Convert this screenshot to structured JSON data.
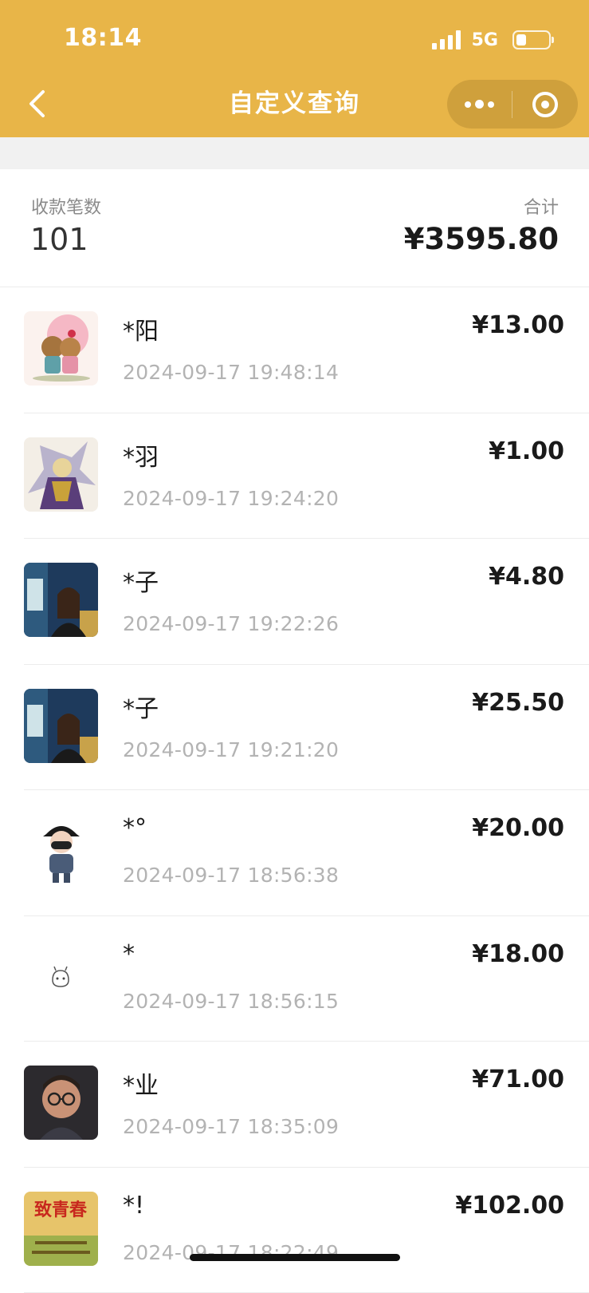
{
  "status_bar": {
    "time": "18:14",
    "network": "5G"
  },
  "nav": {
    "title": "自定义查询"
  },
  "summary": {
    "count_label": "收款笔数",
    "count_value": "101",
    "total_label": "合计",
    "total_value": "¥3595.80"
  },
  "transactions": [
    {
      "name": "*阳",
      "time": "2024-09-17 19:48:14",
      "amount": "¥13.00"
    },
    {
      "name": "*羽",
      "time": "2024-09-17 19:24:20",
      "amount": "¥1.00"
    },
    {
      "name": "*子",
      "time": "2024-09-17 19:22:26",
      "amount": "¥4.80"
    },
    {
      "name": "*子",
      "time": "2024-09-17 19:21:20",
      "amount": "¥25.50"
    },
    {
      "name": "*°",
      "time": "2024-09-17 18:56:38",
      "amount": "¥20.00"
    },
    {
      "name": "*",
      "time": "2024-09-17 18:56:15",
      "amount": "¥18.00"
    },
    {
      "name": "*业",
      "time": "2024-09-17 18:35:09",
      "amount": "¥71.00"
    },
    {
      "name": "*!",
      "time": "2024-09-17 18:22:49",
      "amount": "¥102.00"
    }
  ],
  "colors": {
    "header": "#E8B548",
    "muted_text": "#B3B3B3",
    "divider": "#ECECEC"
  }
}
